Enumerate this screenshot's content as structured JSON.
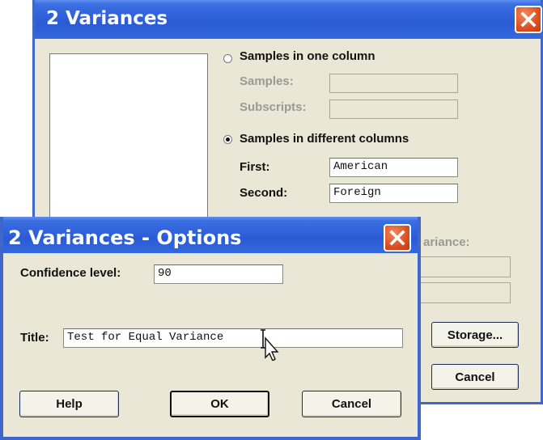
{
  "main_dialog": {
    "title": "2 Variances",
    "radio_one_column": "Samples in one column",
    "samples_label": "Samples:",
    "samples_value": "",
    "subscripts_label": "Subscripts:",
    "subscripts_value": "",
    "radio_diff_columns": "Samples in different columns",
    "first_label": "First:",
    "first_value": "American",
    "second_label": "Second:",
    "second_value": "Foreign",
    "variance_label": "ariance:",
    "storage_label": "Storage...",
    "cancel_label": "Cancel",
    "selected_mode": "different_columns"
  },
  "options_dialog": {
    "title": "2 Variances - Options",
    "confidence_label": "Confidence level:",
    "confidence_value": "90",
    "title_label": "Title:",
    "title_value": "Test for Equal Variance",
    "help_label": "Help",
    "ok_label": "OK",
    "cancel_label": "Cancel"
  },
  "icons": {
    "close": "close-icon",
    "cursor": "text-cursor-arrow-icon"
  },
  "colors": {
    "titlebar": "#2a5bd6",
    "dialog_bg": "#eae7d6",
    "close_button": "#dc4f22"
  }
}
